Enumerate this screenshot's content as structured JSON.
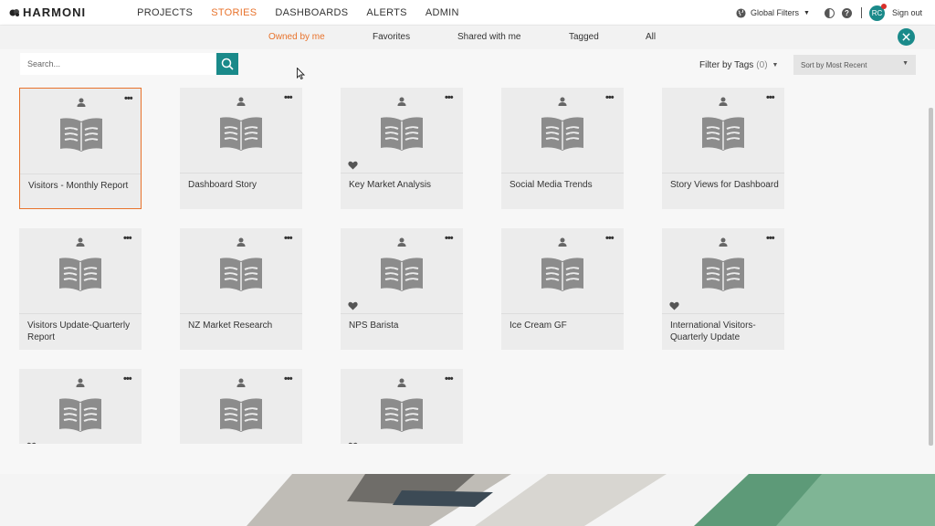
{
  "app": {
    "name": "HARMONI"
  },
  "nav": {
    "items": [
      {
        "label": "PROJECTS",
        "active": false
      },
      {
        "label": "STORIES",
        "active": true
      },
      {
        "label": "DASHBOARDS",
        "active": false
      },
      {
        "label": "ALERTS",
        "active": false
      },
      {
        "label": "ADMIN",
        "active": false
      }
    ],
    "global_filters_label": "Global Filters",
    "avatar_initials": "RC",
    "sign_out_label": "Sign out"
  },
  "subtabs": [
    {
      "label": "Owned by me",
      "active": true
    },
    {
      "label": "Favorites",
      "active": false
    },
    {
      "label": "Shared with me",
      "active": false
    },
    {
      "label": "Tagged",
      "active": false
    },
    {
      "label": "All",
      "active": false
    }
  ],
  "search": {
    "placeholder": "Search..."
  },
  "filter": {
    "label": "Filter by Tags",
    "count": "(0)"
  },
  "sort": {
    "selected": "Sort by Most Recent"
  },
  "stories": [
    {
      "title": "Visitors - Monthly Report",
      "favorite": false,
      "selected": true
    },
    {
      "title": "Dashboard Story",
      "favorite": false,
      "selected": false
    },
    {
      "title": "Key Market Analysis",
      "favorite": true,
      "selected": false
    },
    {
      "title": "Social Media Trends",
      "favorite": false,
      "selected": false
    },
    {
      "title": "Story Views for Dashboard",
      "favorite": false,
      "selected": false
    },
    {
      "title": "Visitors Update-Quarterly Report",
      "favorite": false,
      "selected": false
    },
    {
      "title": "NZ Market Research",
      "favorite": false,
      "selected": false
    },
    {
      "title": "NPS Barista",
      "favorite": true,
      "selected": false
    },
    {
      "title": "Ice Cream GF",
      "favorite": false,
      "selected": false
    },
    {
      "title": "International Visitors-Quarterly Update",
      "favorite": true,
      "selected": false
    },
    {
      "title": "",
      "favorite": true,
      "selected": false
    },
    {
      "title": "",
      "favorite": false,
      "selected": false
    },
    {
      "title": "",
      "favorite": true,
      "selected": false
    }
  ],
  "colors": {
    "accent": "#e8732c",
    "teal": "#1a8a8a",
    "card_bg": "#ececec",
    "icon_gray": "#8c8c8c"
  }
}
